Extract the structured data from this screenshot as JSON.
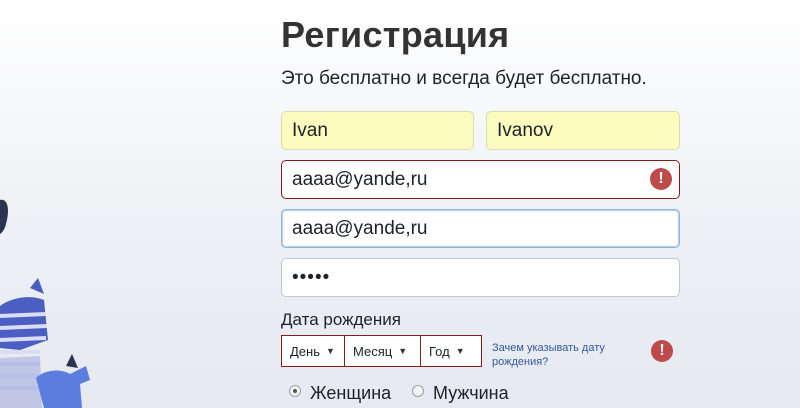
{
  "header": {
    "title": "Регистрация",
    "subtitle": "Это бесплатно и всегда будет бесплатно."
  },
  "form": {
    "first_name": "Ivan",
    "last_name": "Ivanov",
    "email": "aaaa@yande,ru",
    "email_confirm": "aaaa@yande,ru",
    "password_mask": "•••••",
    "error_icon_glyph": "!"
  },
  "birthday": {
    "label": "Дата рождения",
    "day": "День",
    "month": "Месяц",
    "year": "Год",
    "caret": "▼",
    "why_link": "Зачем указывать дату рождения?"
  },
  "gender": {
    "female": "Женщина",
    "male": "Мужчина",
    "selected": "female"
  },
  "colors": {
    "error": "#be4b49",
    "autofill": "#fbfcbd",
    "link": "#365899"
  }
}
